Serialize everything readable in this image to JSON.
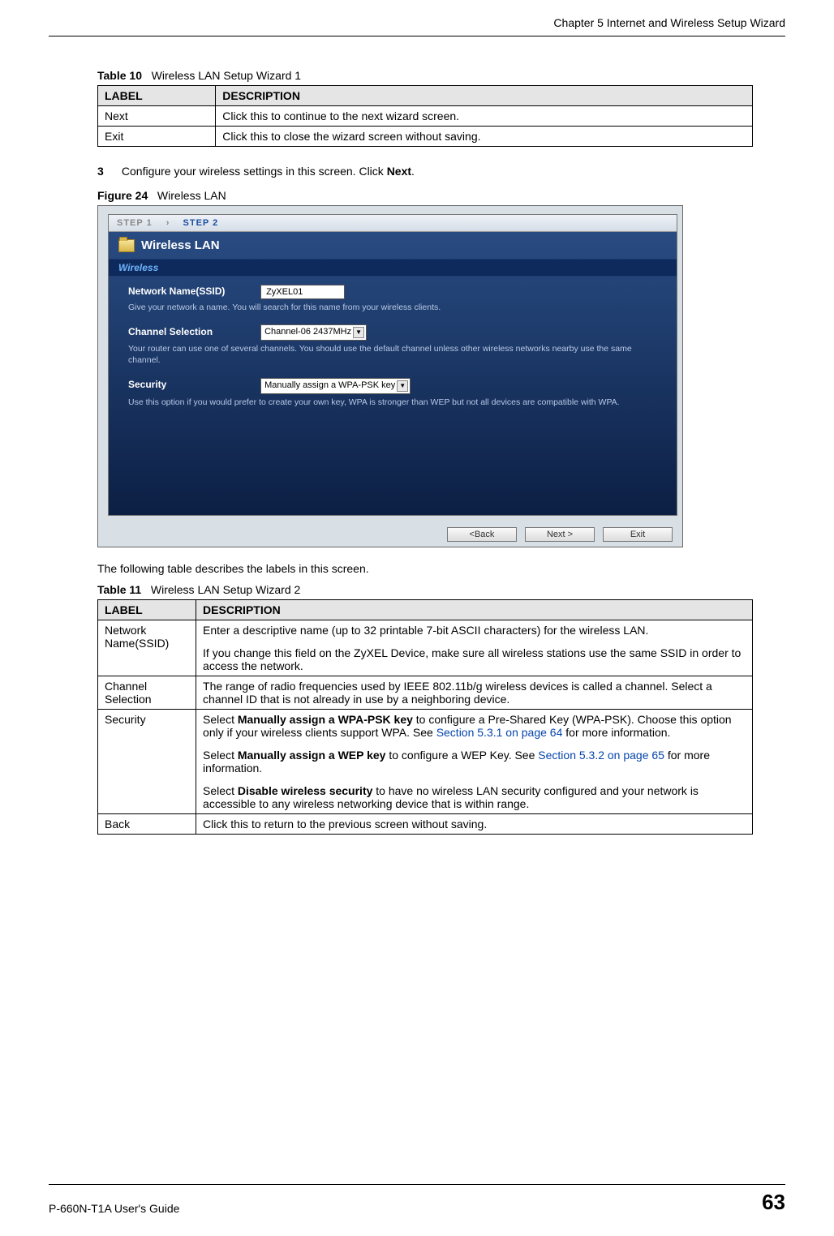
{
  "header": {
    "chapter": "Chapter 5 Internet and Wireless Setup Wizard"
  },
  "table10": {
    "caption_label": "Table 10",
    "caption_text": "Wireless LAN Setup Wizard 1",
    "col_label": "LABEL",
    "col_desc": "DESCRIPTION",
    "rows": [
      {
        "label": "Next",
        "desc": "Click this to continue to the next wizard screen."
      },
      {
        "label": "Exit",
        "desc": "Click this to close the wizard screen without saving."
      }
    ]
  },
  "step3": {
    "num": "3",
    "text_a": "Configure your wireless settings in this screen. Click ",
    "bold": "Next",
    "text_b": "."
  },
  "figure": {
    "caption_label": "Figure 24",
    "caption_text": "Wireless LAN",
    "step1": "STEP 1",
    "arrow": "›",
    "step2": "STEP 2",
    "title": "Wireless LAN",
    "section": "Wireless",
    "ssid_label": "Network Name(SSID)",
    "ssid_value": "ZyXEL01",
    "ssid_hint": "Give your network a name. You will search for this name from your wireless clients.",
    "chan_label": "Channel Selection",
    "chan_value": "Channel-06 2437MHz",
    "chan_hint": "Your router can use one of several channels. You should use the default channel unless other wireless networks nearby use the same channel.",
    "sec_label": "Security",
    "sec_value": "Manually assign a WPA-PSK key",
    "sec_hint": "Use this option if you would prefer to create your own key, WPA is stronger than WEP but not all devices are compatible with WPA.",
    "btn_back": "<Back",
    "btn_next": "Next >",
    "btn_exit": "Exit"
  },
  "between_para": "The following table describes the labels in this screen.",
  "table11": {
    "caption_label": "Table 11",
    "caption_text": "Wireless LAN Setup Wizard 2",
    "col_label": "LABEL",
    "col_desc": "DESCRIPTION",
    "r1": {
      "label": "Network Name(SSID)",
      "p1": "Enter a descriptive name (up to 32 printable 7-bit ASCII characters) for the wireless LAN.",
      "p2": "If you change this field on the ZyXEL Device, make sure all wireless stations use the same SSID in order to access the network."
    },
    "r2": {
      "label": "Channel Selection",
      "p1": "The range of radio frequencies used by IEEE 802.11b/g wireless devices is called a channel. Select a channel ID that is not already in use by a neighboring device."
    },
    "r3": {
      "label": "Security",
      "p1a": "Select ",
      "p1b": "Manually assign a WPA-PSK key",
      "p1c": " to configure a Pre-Shared Key (WPA-PSK). Choose this option only if your wireless clients support WPA. See ",
      "p1link": "Section 5.3.1 on page 64",
      "p1d": " for more information.",
      "p2a": "Select ",
      "p2b": "Manually assign a WEP key",
      "p2c": " to configure a WEP Key. See ",
      "p2link": "Section 5.3.2 on page 65",
      "p2d": " for more information.",
      "p3a": "Select ",
      "p3b": "Disable wireless security",
      "p3c": " to have no wireless LAN security configured and your network is accessible to any wireless networking device that is within range."
    },
    "r4": {
      "label": "Back",
      "p1": "Click this to return to the previous screen without saving."
    }
  },
  "footer": {
    "guide": "P-660N-T1A User's Guide",
    "page": "63"
  }
}
